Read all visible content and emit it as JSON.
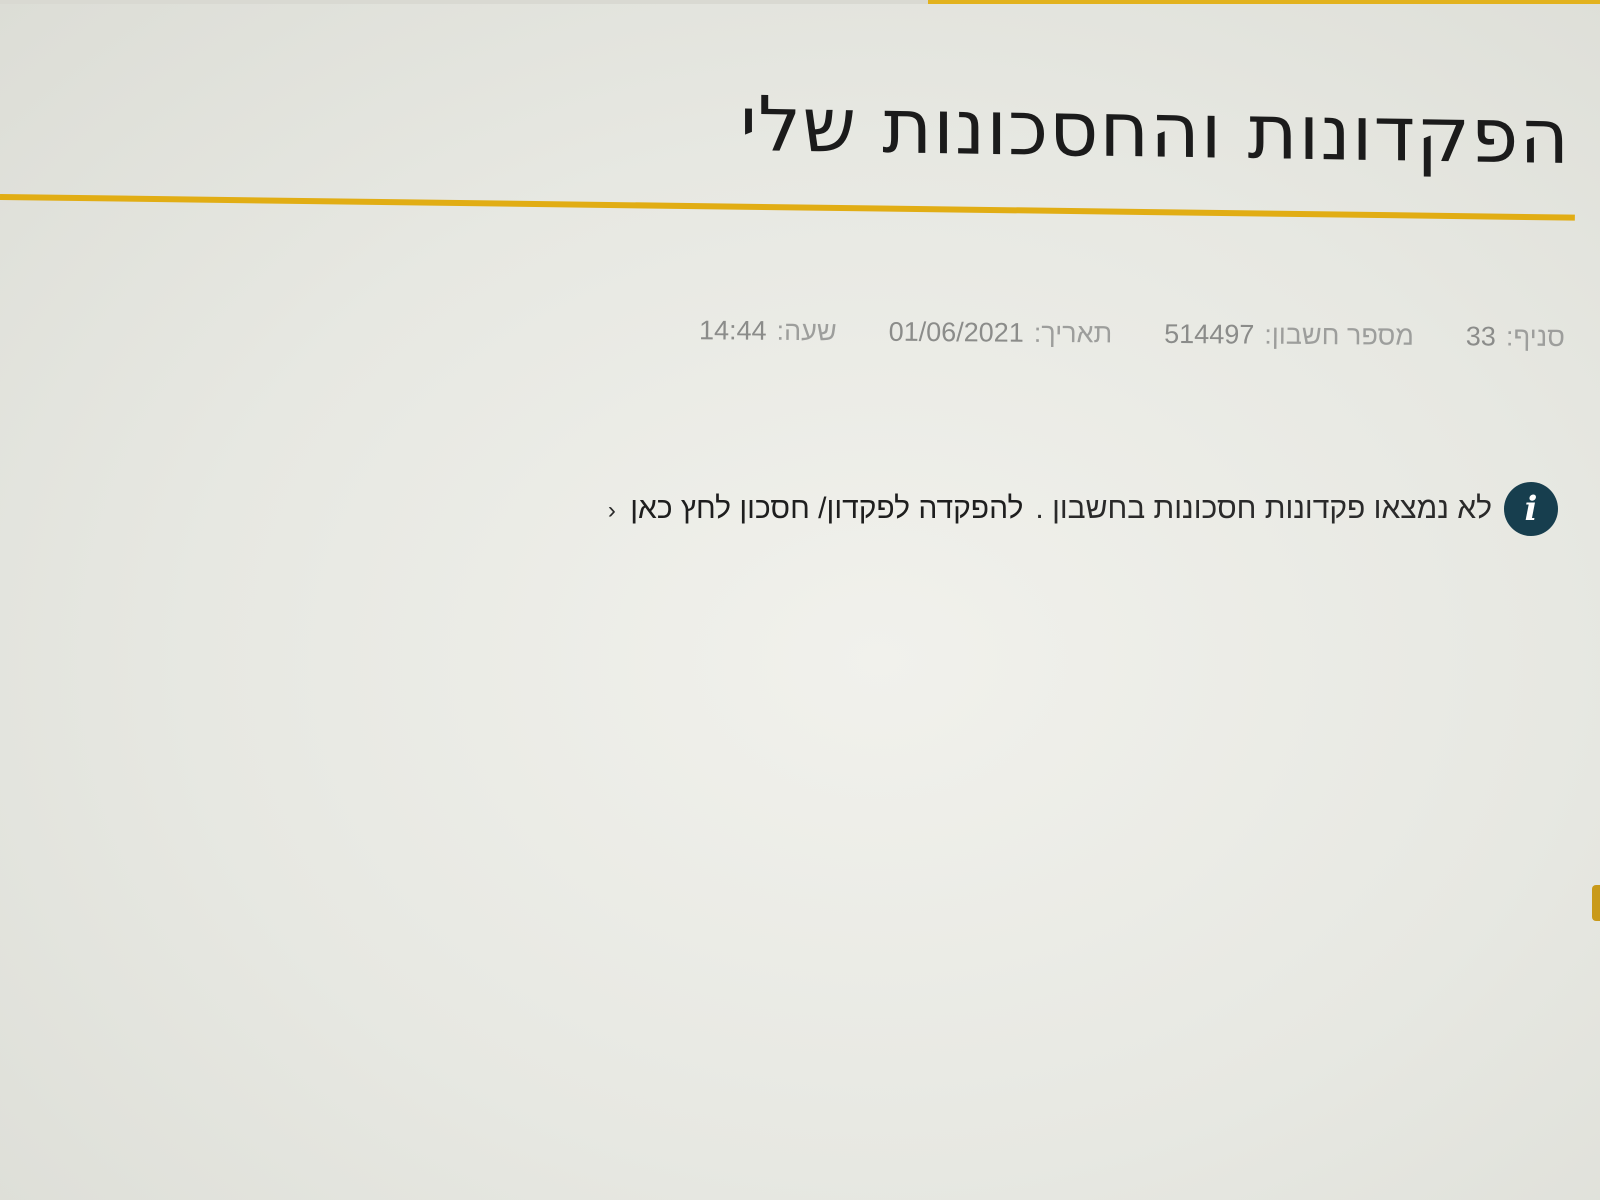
{
  "page": {
    "title": "הפקדונות והחסכונות שלי"
  },
  "meta": {
    "branch_label": "סניף:",
    "branch_value": "33",
    "account_label": "מספר חשבון:",
    "account_value": "514497",
    "date_label": "תאריך:",
    "date_value": "01/06/2021",
    "time_label": "שעה:",
    "time_value": "14:44"
  },
  "notice": {
    "message": "לא נמצאו פקדונות חסכונות בחשבון .",
    "link_label": "להפקדה לפקדון/ חסכון לחץ כאן",
    "chevron": "‹"
  },
  "icons": {
    "info": "info-icon",
    "link_arrow": "chevron-left-icon"
  },
  "colors": {
    "accent": "#e1ad14",
    "info_icon_bg": "#173e4e",
    "meta_text": "#9d9e9c"
  }
}
